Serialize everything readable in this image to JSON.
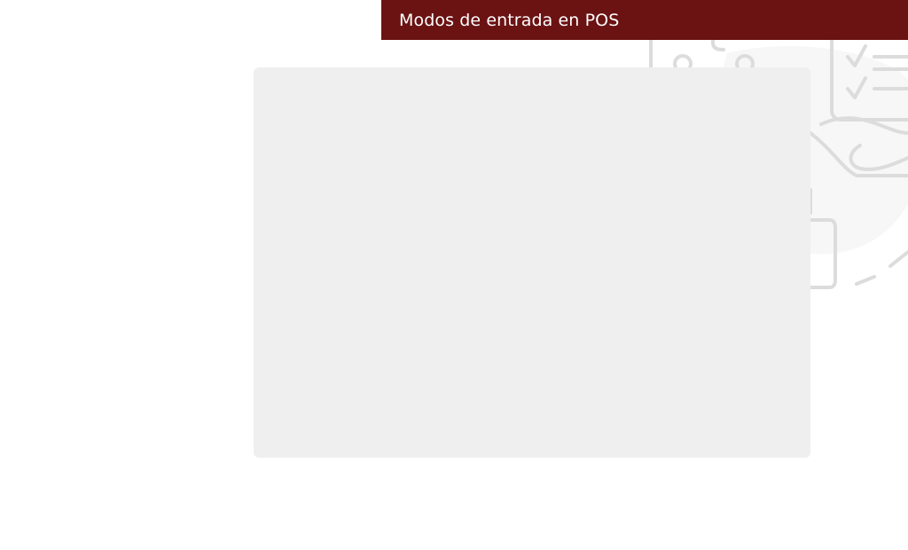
{
  "header": {
    "title": "Modos de entrada en POS"
  },
  "theme": {
    "accent": "#6b1212",
    "panel": "#efefef",
    "illustration_stroke": "#dcdcdc",
    "illustration_fill": "#f7f7f7"
  },
  "background": {
    "icon": "pos-checklist-illustration"
  }
}
